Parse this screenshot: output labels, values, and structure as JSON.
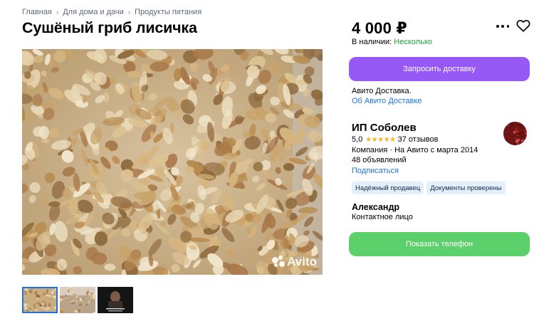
{
  "breadcrumb": [
    {
      "label": "Главная"
    },
    {
      "label": "Для дома и дачи"
    },
    {
      "label": "Продукты питания"
    }
  ],
  "title": "Сушёный гриб лисичка",
  "watermark": "Avito",
  "price": "4 000 ₽",
  "stock": {
    "label": "В наличии:",
    "value": "Несколько"
  },
  "delivery_button": "Запросить доставку",
  "delivery": {
    "text": "Авито Доставка.",
    "link": "Об Авито Доставке"
  },
  "seller": {
    "name": "ИП Соболев",
    "rating": "5,0",
    "stars": "★★★★★",
    "reviews": "37 отзывов",
    "company": "Компания · На Авито с марта 2014",
    "ads": "48 объявлений",
    "subscribe": "Подписаться",
    "badges": [
      "Надёжный продавец",
      "Документы проверены"
    ]
  },
  "contact": {
    "name": "Александр",
    "role": "Контактное лицо"
  },
  "phone_button": "Показать телефон",
  "colors": {
    "delivery_button": "#9759f5",
    "phone_button": "#5cd06a",
    "link": "#1a73e8",
    "in_stock": "#1aa33a",
    "stars": "#ffb021"
  }
}
